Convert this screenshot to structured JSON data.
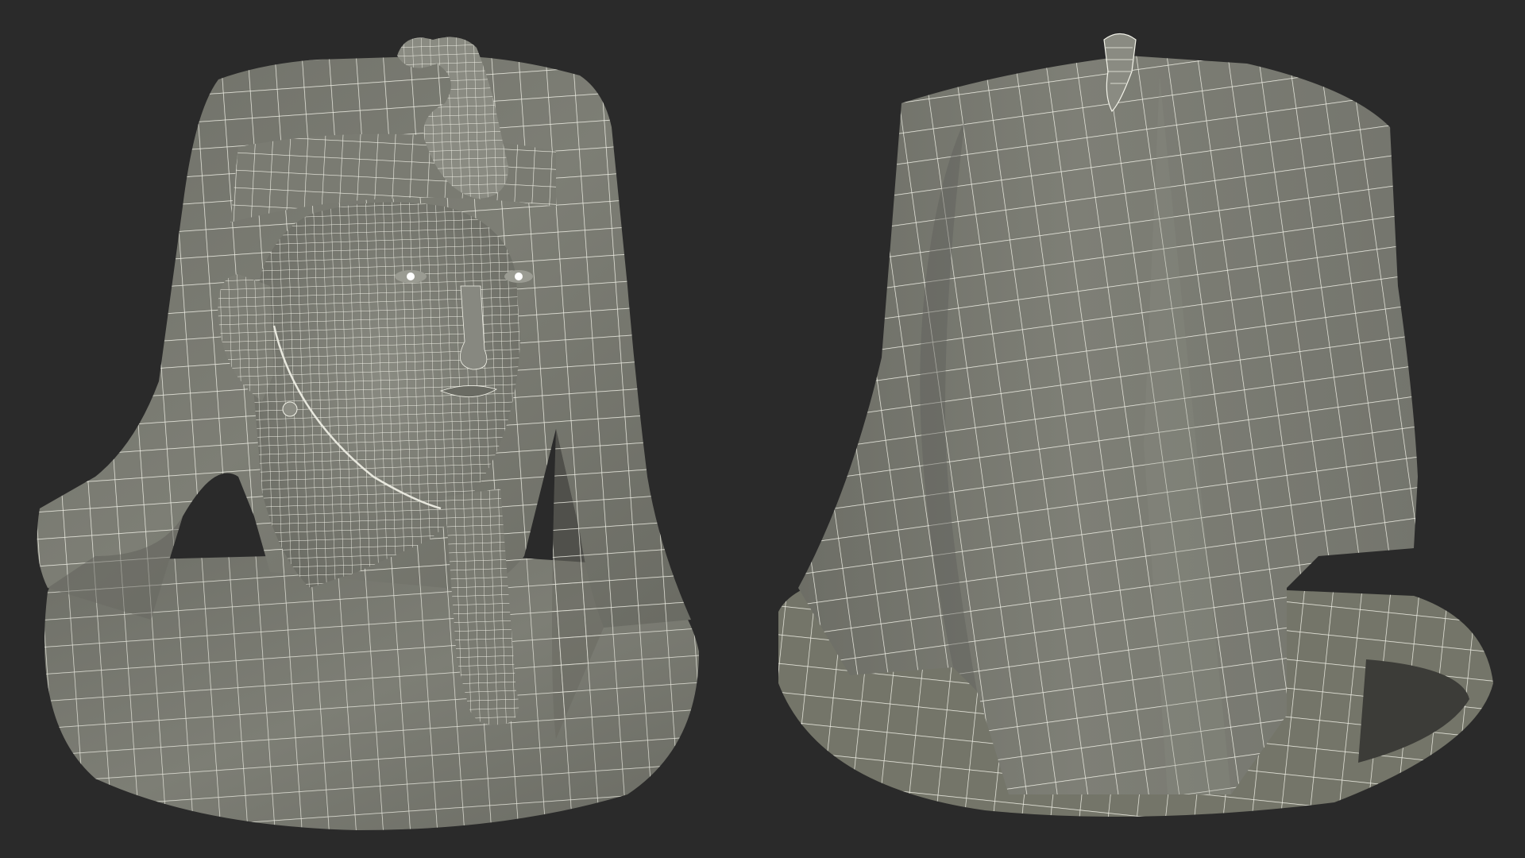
{
  "scene": {
    "background_color": "#2a2a2a",
    "mesh_fill_color": "#7a7b72",
    "mesh_shadow_color": "#5f605a",
    "mesh_highlight_color": "#8d8e85",
    "wire_color": "#f2f2e8",
    "subject": "pharaoh-bust-wireframe",
    "views": [
      {
        "name": "front-three-quarter",
        "icon": "pharaoh-head-front"
      },
      {
        "name": "back-three-quarter",
        "icon": "pharaoh-head-back"
      }
    ]
  }
}
